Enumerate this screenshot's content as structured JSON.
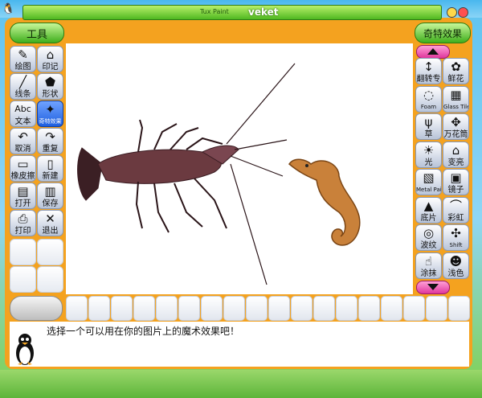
{
  "window": {
    "app_name": "Tux Paint",
    "title": "veket"
  },
  "left_header": "工具",
  "right_header": "奇特效果",
  "tools": [
    {
      "name": "paint",
      "label": "绘图",
      "icon": "✎"
    },
    {
      "name": "stamp",
      "label": "印记",
      "icon": "⌂"
    },
    {
      "name": "lines",
      "label": "线条",
      "icon": "╱"
    },
    {
      "name": "shapes",
      "label": "形状",
      "icon": "⬟"
    },
    {
      "name": "text",
      "label": "文本",
      "icon": "Abc"
    },
    {
      "name": "magic",
      "label": "奇特效果",
      "icon": "✦"
    },
    {
      "name": "undo",
      "label": "取消",
      "icon": "↶"
    },
    {
      "name": "redo",
      "label": "重复",
      "icon": "↷"
    },
    {
      "name": "eraser",
      "label": "橡皮擦",
      "icon": "▭"
    },
    {
      "name": "new",
      "label": "新建",
      "icon": "▯"
    },
    {
      "name": "open",
      "label": "打开",
      "icon": "▤"
    },
    {
      "name": "save",
      "label": "保存",
      "icon": "▥"
    },
    {
      "name": "print",
      "label": "打印",
      "icon": "⎙"
    },
    {
      "name": "quit",
      "label": "退出",
      "icon": "✕"
    }
  ],
  "magic_tools": [
    {
      "name": "flip",
      "label": "翻转专",
      "icon": "↕"
    },
    {
      "name": "flower",
      "label": "鲜花",
      "icon": "✿"
    },
    {
      "name": "foam",
      "label": "Foam",
      "icon": "◌"
    },
    {
      "name": "glass-tile",
      "label": "Glass Tile",
      "icon": "▦"
    },
    {
      "name": "grass",
      "label": "草",
      "icon": "ψ"
    },
    {
      "name": "kaleidoscope",
      "label": "万花筒",
      "icon": "✥"
    },
    {
      "name": "light",
      "label": "光",
      "icon": "☀"
    },
    {
      "name": "lighten",
      "label": "变亮",
      "icon": "⌂"
    },
    {
      "name": "metal-paint",
      "label": "Metal Paint",
      "icon": "▧"
    },
    {
      "name": "mirror",
      "label": "镜子",
      "icon": "▣"
    },
    {
      "name": "negative",
      "label": "底片",
      "icon": "▲"
    },
    {
      "name": "rainbow",
      "label": "彩虹",
      "icon": "⌒"
    },
    {
      "name": "ripples",
      "label": "波纹",
      "icon": "◎"
    },
    {
      "name": "shift",
      "label": "Shift",
      "icon": "✣"
    },
    {
      "name": "smudge",
      "label": "涂抹",
      "icon": "☝"
    },
    {
      "name": "tint",
      "label": "浅色",
      "icon": "☻"
    }
  ],
  "status_message": "选择一个可以用在你的图片上的魔术效果吧！",
  "colors": {
    "frame": "#f4a21f",
    "header_green": "#3fae1d",
    "selected_tool": "#1e5fe0",
    "scroll": "#e0379d"
  }
}
